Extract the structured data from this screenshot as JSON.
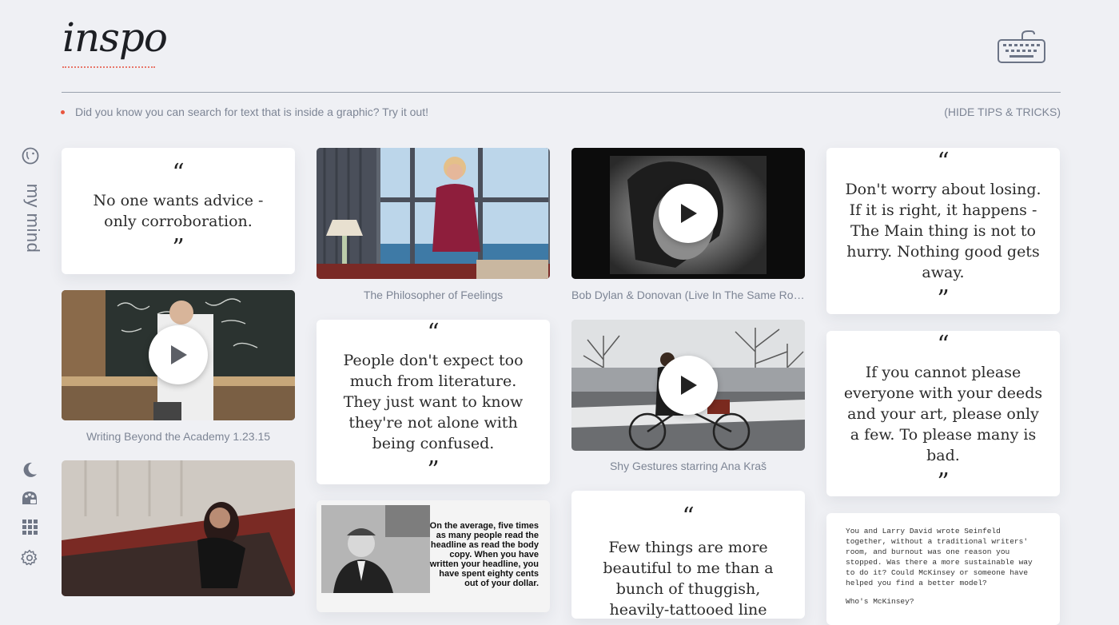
{
  "app": {
    "logo": "inspo"
  },
  "header": {
    "tip_text": "Did you know you can search for text that is inside a graphic? Try it out!",
    "hide_tips_label": "(HIDE TIPS & TRICKS)"
  },
  "sidebar": {
    "my_mind_label": "my mind",
    "icons": [
      "moon-icon",
      "palette-icon",
      "grid-icon",
      "gear-icon"
    ]
  },
  "cards": {
    "quote1": {
      "open": "“",
      "text": "No one wants advice - only corroboration.",
      "close": "”"
    },
    "video_writing": {
      "caption": "Writing Beyond the Academy 1.23.15"
    },
    "image_philosopher": {
      "caption": "The Philosopher of Feelings"
    },
    "quote2": {
      "open": "“",
      "text": "People don't expect too much from literature. They just want to know they're not alone with being confused.",
      "close": "”"
    },
    "ad_image": {
      "text": "On the average, five times as many people read the headline as read the body copy. When you have written your headline, you have spent eighty cents out of your dollar."
    },
    "video_dylan": {
      "caption": "Bob Dylan & Donovan (Live In The Same Roo..."
    },
    "video_shy": {
      "caption": "Shy Gestures starring Ana Kraš"
    },
    "quote3": {
      "open": "“",
      "text": "Few things are more beautiful to me than a bunch of thuggish, heavily-tattooed line cooks mov-"
    },
    "quote4": {
      "open": "“",
      "text": "Don't worry about losing. If it is right, it happens - The Main thing is not to hurry. Nothing good gets away.",
      "close": "”"
    },
    "quote5": {
      "open": "“",
      "text": "If you cannot please everyone with your deeds and your art, please only a few. To please many is bad.",
      "close": "”"
    },
    "text_note": {
      "para": "You and Larry David wrote Seinfeld together, without a traditional writers' room, and burnout was one reason you stopped. Was there a more sustainable way to do it? Could McKinsey or someone have helped you find a better model?",
      "q": "Who's McKinsey?"
    }
  },
  "colors": {
    "accent": "#e8553e",
    "background": "#eff0f4",
    "card": "#ffffff"
  }
}
